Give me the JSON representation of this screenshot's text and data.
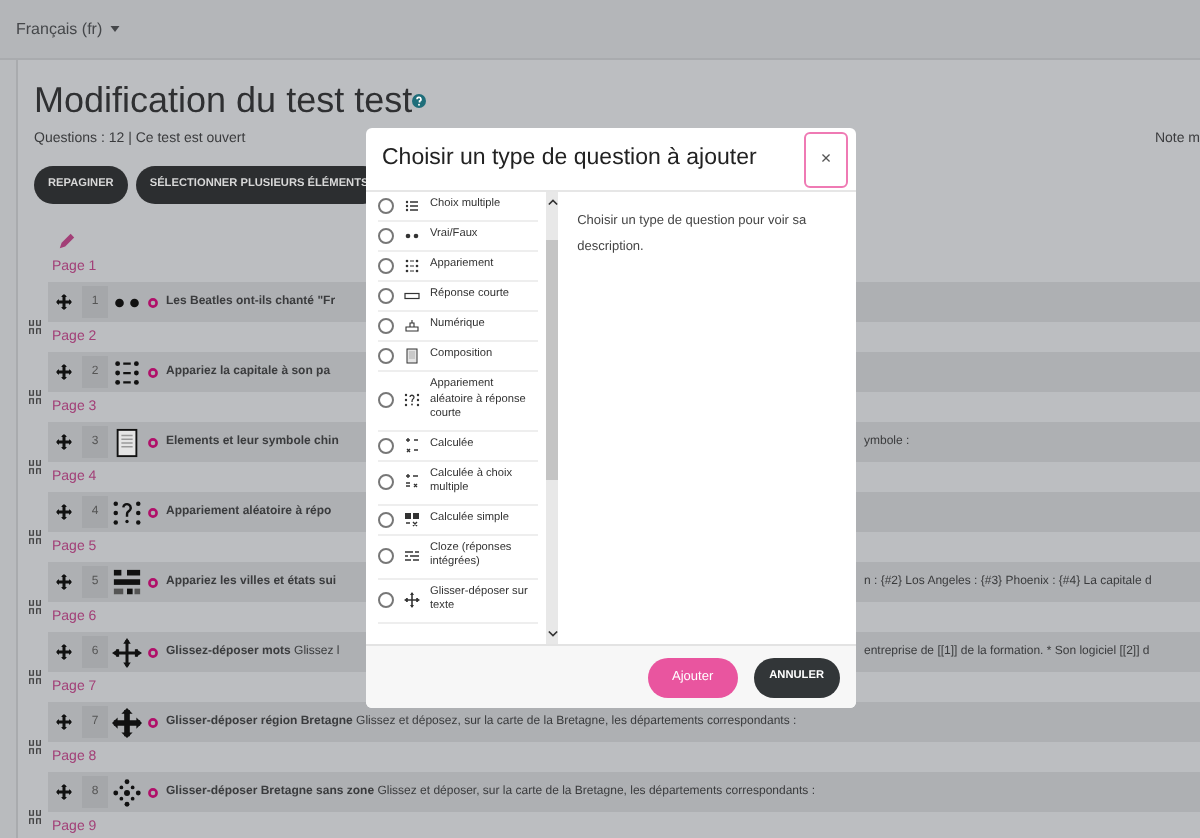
{
  "language_menu": "Français (fr)",
  "title": "Modification du test test",
  "status": "Questions : 12 | Ce test est ouvert",
  "max_grade_label": "Note m",
  "buttons": [
    "REPAGINER",
    "SÉLECTIONNER PLUSIEURS ÉLÉMENTS"
  ],
  "pages": [
    {
      "label": "Page 1",
      "question": {
        "number": "1",
        "kind": "truefalse",
        "name": "Les Beatles ont-ils chanté \"Fr"
      }
    },
    {
      "label": "Page 2",
      "question": {
        "number": "2",
        "kind": "match",
        "name": "Appariez la capitale à son pa"
      }
    },
    {
      "label": "Page 3",
      "question": {
        "number": "3",
        "kind": "essay",
        "name": "Elements et leur symbole chin",
        "text_right": "ymbole :"
      }
    },
    {
      "label": "Page 4",
      "question": {
        "number": "4",
        "kind": "randomsamatch",
        "name": "Appariement aléatoire à répo"
      }
    },
    {
      "label": "Page 5",
      "question": {
        "number": "5",
        "kind": "gapselect",
        "name": "Appariez les villes et états sui",
        "text_right": "n : {#2} Los Angeles : {#3} Phoenix : {#4} La capitale d"
      }
    },
    {
      "label": "Page 6",
      "question": {
        "number": "6",
        "kind": "ddwtos",
        "name": "Glissez-déposer mots",
        "text": "Glissez l",
        "text_right": "entreprise de [[1]] de la formation. * Son logiciel [[2]] d"
      }
    },
    {
      "label": "Page 7",
      "question": {
        "number": "7",
        "kind": "ddmarker",
        "name": "Glisser-déposer région Bretagne",
        "text": "Glissez et déposez, sur la carte de la Bretagne, les départements correspondants :"
      }
    },
    {
      "label": "Page 8",
      "question": {
        "number": "8",
        "kind": "ddimageortext",
        "name": "Glisser-déposer Bretagne sans zone",
        "text": "Glissez et déposer, sur la carte de la Bretagne, les départements correspondants :"
      }
    },
    {
      "label": "Page 9"
    }
  ],
  "modal": {
    "title": "Choisir un type de question à ajouter",
    "close": "×",
    "question_types": [
      {
        "label": "Choix multiple",
        "kind": "multichoice",
        "selected": false
      },
      {
        "label": "Vrai/Faux",
        "kind": "truefalse",
        "selected": false
      },
      {
        "label": "Appariement",
        "kind": "match",
        "selected": false
      },
      {
        "label": "Réponse courte",
        "kind": "shortanswer",
        "selected": false
      },
      {
        "label": "Numérique",
        "kind": "numerical",
        "selected": false
      },
      {
        "label": "Composition",
        "kind": "essay",
        "selected": false
      },
      {
        "label": "Appariement aléatoire à réponse courte",
        "kind": "randomsamatch",
        "selected": false
      },
      {
        "label": "Calculée",
        "kind": "calculated",
        "selected": false
      },
      {
        "label": "Calculée à choix multiple",
        "kind": "calculatedmulti",
        "selected": false
      },
      {
        "label": "Calculée simple",
        "kind": "calculatedsimple",
        "selected": false
      },
      {
        "label": "Cloze (réponses intégrées)",
        "kind": "multianswer",
        "selected": false
      },
      {
        "label": "Glisser-déposer sur texte",
        "kind": "ddwtos",
        "selected": false
      }
    ],
    "description": "Choisir un type de question pour voir sa description.",
    "buttons": [
      {
        "label": "Ajouter",
        "kind": "primary"
      },
      {
        "label": "ANNULER",
        "kind": "secondary"
      }
    ]
  }
}
